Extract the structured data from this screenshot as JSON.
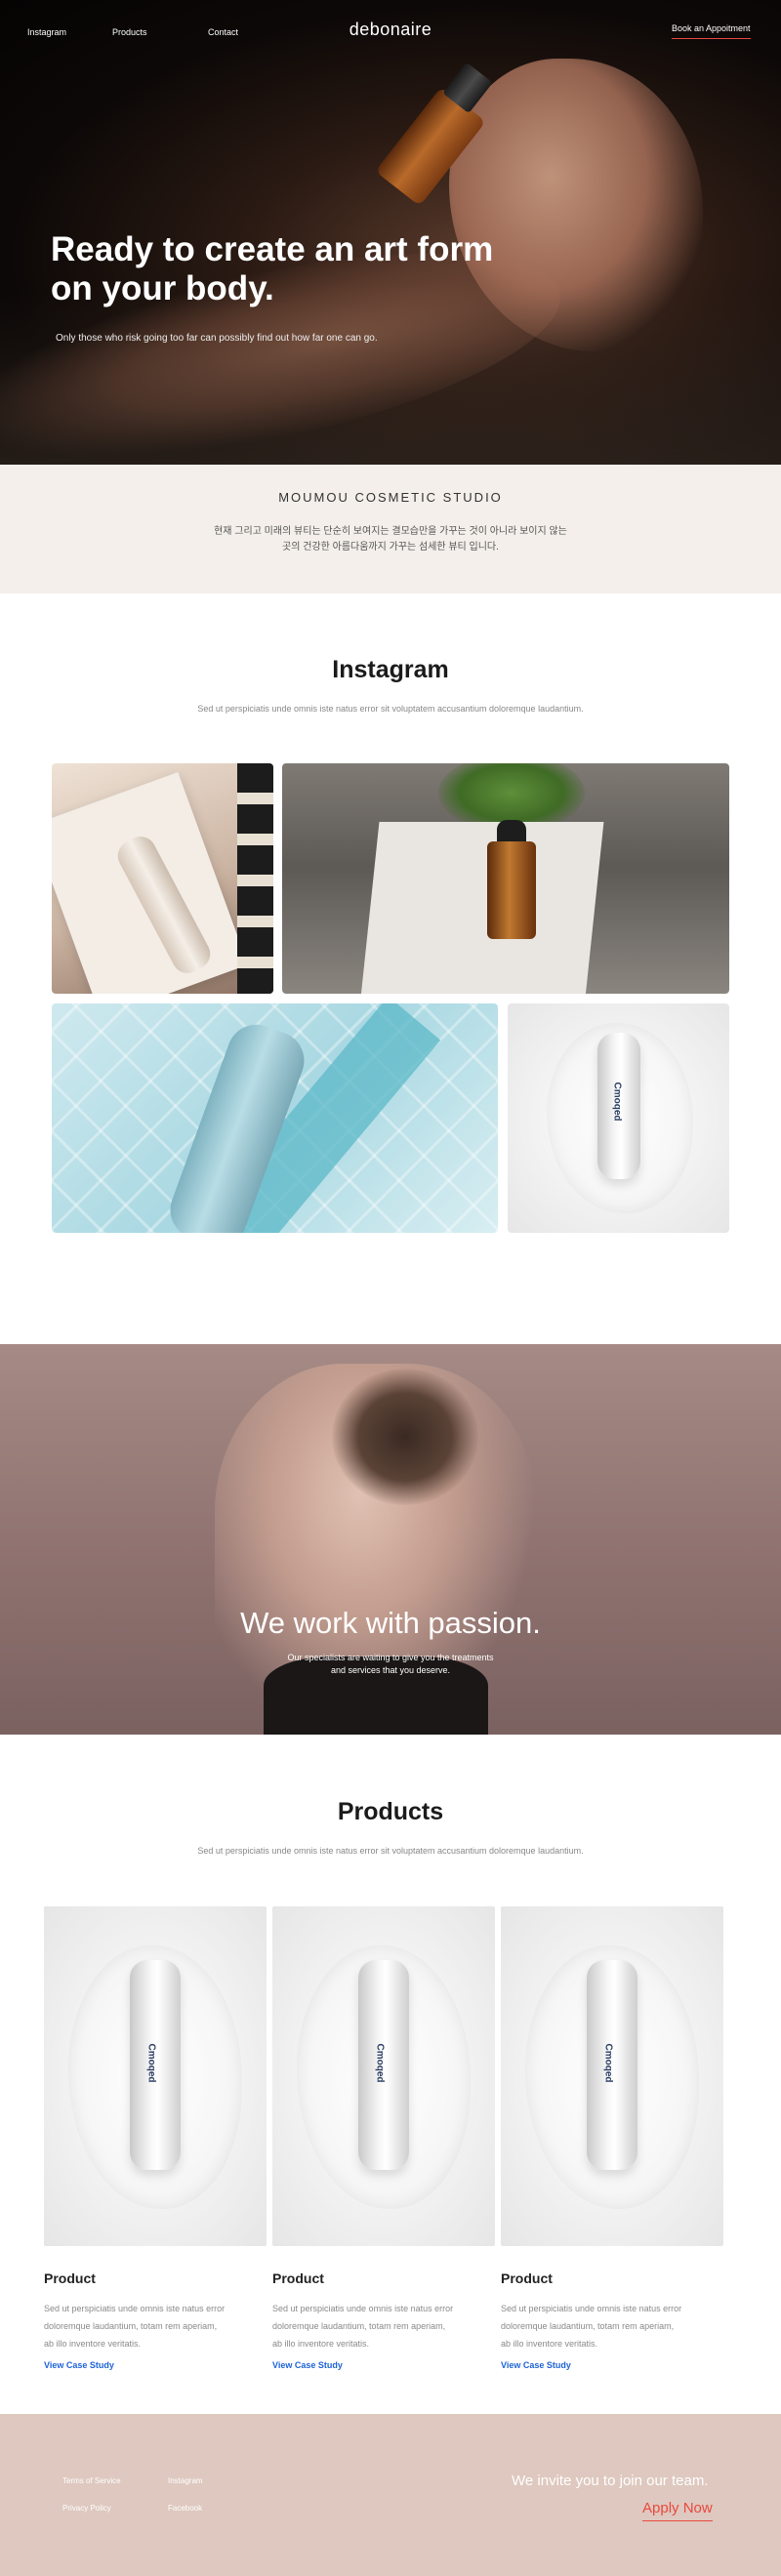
{
  "nav": {
    "instagram": "Instagram",
    "products": "Products",
    "contact": "Contact",
    "brand": "debonaire",
    "cta": "Book an Appoitment"
  },
  "hero": {
    "title": "Ready to create an art form on your body.",
    "subtitle": "Only those who risk going too far can possibly find out how far one can go."
  },
  "studio": {
    "title": "MOUMOU COSMETIC STUDIO",
    "line1": "현재 그리고 미래의 뷰티는 단순히 보여지는 결모습만을 가꾸는 것이 아니라 보이지 않는",
    "line2": "곳의 건강한 아름다움까지 가꾸는 섬세한 뷰티 입니다."
  },
  "instagram": {
    "title": "Instagram",
    "subtitle": "Sed ut perspiciatis unde omnis iste natus error sit voluptatem accusantium doloremque laudantium."
  },
  "product_label": "Cmoqed",
  "passion": {
    "title": "We work with passion.",
    "line1": "Our specialists are waiting to give you the treatments",
    "line2": "and services that you deserve."
  },
  "products": {
    "title": "Products",
    "subtitle": "Sed ut perspiciatis unde omnis iste natus error sit voluptatem accusantium doloremque laudantium.",
    "items": [
      {
        "title": "Product",
        "desc1": "Sed ut perspiciatis unde omnis iste natus error",
        "desc2": "doloremque laudantium, totam rem aperiam,",
        "desc3": "ab illo inventore veritatis.",
        "link": "View Case Study"
      },
      {
        "title": "Product",
        "desc1": "Sed ut perspiciatis unde omnis iste natus error",
        "desc2": "doloremque laudantium, totam rem aperiam,",
        "desc3": "ab illo inventore veritatis.",
        "link": "View Case Study"
      },
      {
        "title": "Product",
        "desc1": "Sed ut perspiciatis unde omnis iste natus error",
        "desc2": "doloremque laudantium, totam rem aperiam,",
        "desc3": "ab illo inventore veritatis.",
        "link": "View Case Study"
      }
    ]
  },
  "footer": {
    "terms": "Terms of Service",
    "instagram": "Instagram",
    "privacy": "Privacy Policy",
    "facebook": "Facebook",
    "invite": "We invite you to join our team.",
    "apply": "Apply Now"
  },
  "colors": {
    "accent": "#e9493f",
    "link": "#1e63d6",
    "studio_bg": "#f4efea",
    "footer_bg": "#dec8bf"
  }
}
